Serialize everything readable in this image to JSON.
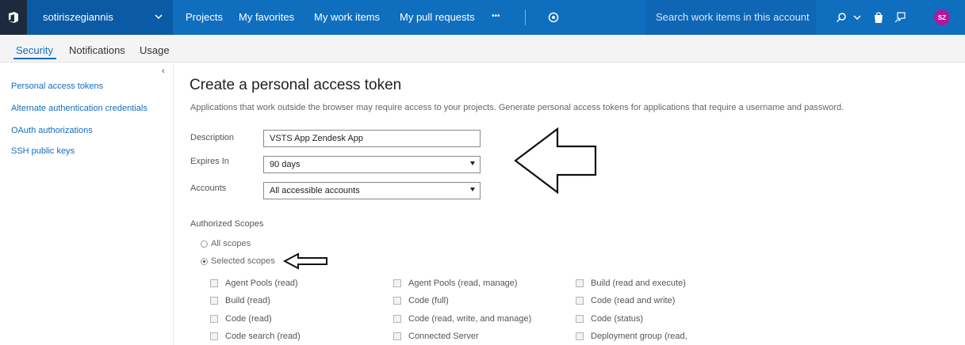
{
  "topbar": {
    "account_name": "sotiriszegiannis",
    "nav_items": [
      "Projects",
      "My favorites",
      "My work items",
      "My pull requests"
    ],
    "more_label": "•••",
    "search_placeholder": "Search work items in this account",
    "avatar_initials": "SZ",
    "colors": {
      "bar": "#106ebe",
      "logo_bg": "#1d2a3d",
      "avatar": "#b0179b"
    }
  },
  "tabs": [
    "Security",
    "Notifications",
    "Usage"
  ],
  "sidebar": {
    "collapse_icon": "chevron-left-icon",
    "items": [
      "Personal access tokens",
      "Alternate authentication credentials",
      "OAuth authorizations",
      "SSH public keys"
    ]
  },
  "main": {
    "title": "Create a personal access token",
    "description": "Applications that work outside the browser may require access to your projects. Generate personal access tokens for applications that require a username and password.",
    "fields": {
      "description_label": "Description",
      "description_value": "VSTS App Zendesk App",
      "expires_label": "Expires In",
      "expires_value": "90 days",
      "accounts_label": "Accounts",
      "accounts_value": "All accessible accounts"
    },
    "scopes": {
      "label": "Authorized Scopes",
      "all_label": "All scopes",
      "selected_label": "Selected scopes",
      "selected": "Selected scopes",
      "columns": [
        [
          "Agent Pools (read)",
          "Build (read)",
          "Code (read)",
          "Code search (read)"
        ],
        [
          "Agent Pools (read, manage)",
          "Code (full)",
          "Code (read, write, and manage)",
          "Connected Server"
        ],
        [
          "Build (read and execute)",
          "Code (read and write)",
          "Code (status)",
          "Deployment group (read,"
        ]
      ]
    }
  }
}
